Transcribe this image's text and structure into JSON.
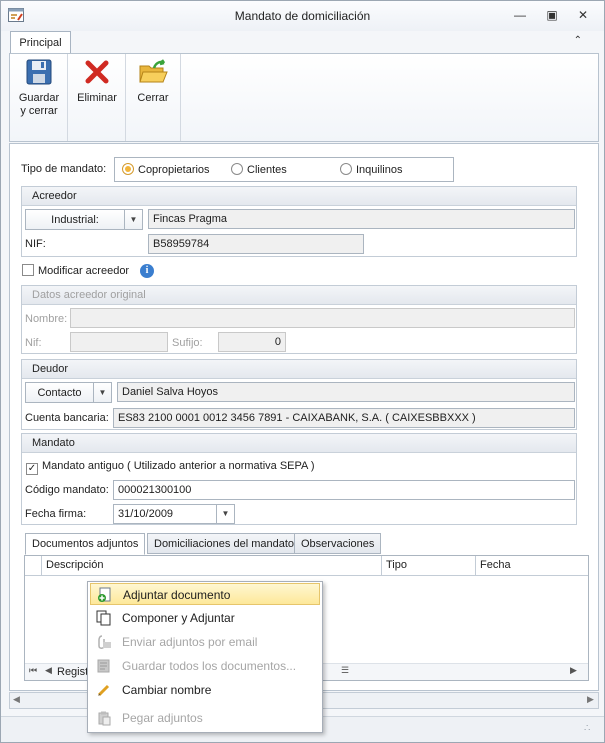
{
  "window": {
    "title": "Mandato de domiciliación"
  },
  "ribbon": {
    "tab": "Principal",
    "buttons": {
      "save_line1": "Guardar",
      "save_line2": "y cerrar",
      "delete": "Eliminar",
      "close": "Cerrar"
    }
  },
  "mandate_type": {
    "label": "Tipo de mandato:",
    "options": [
      "Copropietarios",
      "Clientes",
      "Inquilinos"
    ],
    "selected": "Copropietarios"
  },
  "creditor": {
    "title": "Acreedor",
    "type_value": "Industrial:",
    "name": "Fincas Pragma",
    "nif_label": "NIF:",
    "nif": "B58959784"
  },
  "modify_creditor": {
    "label": "Modificar acreedor",
    "checked": false
  },
  "original_creditor": {
    "title": "Datos acreedor original",
    "name_label": "Nombre:",
    "nif_label": "Nif:",
    "suffix_label": "Sufijo:",
    "suffix_value": "0"
  },
  "debtor": {
    "title": "Deudor",
    "type_value": "Contacto",
    "name": "Daniel Salva Hoyos",
    "account_label": "Cuenta bancaria:",
    "account": "ES83 2100 0001 0012 3456 7891 - CAIXABANK, S.A. ( CAIXESBBXXX )"
  },
  "mandate": {
    "title": "Mandato",
    "old_mandate_label": "Mandato antiguo ( Utilizado anterior a normativa SEPA )",
    "old_mandate_checked": true,
    "code_label": "Código mandato:",
    "code": "000021300100",
    "date_label": "Fecha firma:",
    "date": "31/10/2009"
  },
  "tabs": [
    "Documentos adjuntos",
    "Domiciliaciones del mandato",
    "Observaciones"
  ],
  "grid": {
    "columns": [
      "Descripción",
      "Tipo",
      "Fecha"
    ],
    "footer_text": "Regist"
  },
  "context_menu": {
    "items": [
      {
        "label": "Adjuntar documento",
        "icon": "attach-add-icon",
        "enabled": true,
        "highlighted": true
      },
      {
        "label": "Componer y Adjuntar",
        "icon": "compose-icon",
        "enabled": true
      },
      {
        "label": "Enviar adjuntos por email",
        "icon": "email-attach-icon",
        "enabled": false
      },
      {
        "label": "Guardar todos los documentos...",
        "icon": "save-docs-icon",
        "enabled": false
      },
      {
        "label": "Cambiar nombre",
        "icon": "pencil-icon",
        "enabled": true
      },
      {
        "label": "Pegar adjuntos",
        "icon": "paste-icon",
        "enabled": false
      }
    ]
  },
  "colors": {
    "accent": "#f2b43a",
    "highlight": "#fde89a",
    "info": "#3a7ecf"
  }
}
